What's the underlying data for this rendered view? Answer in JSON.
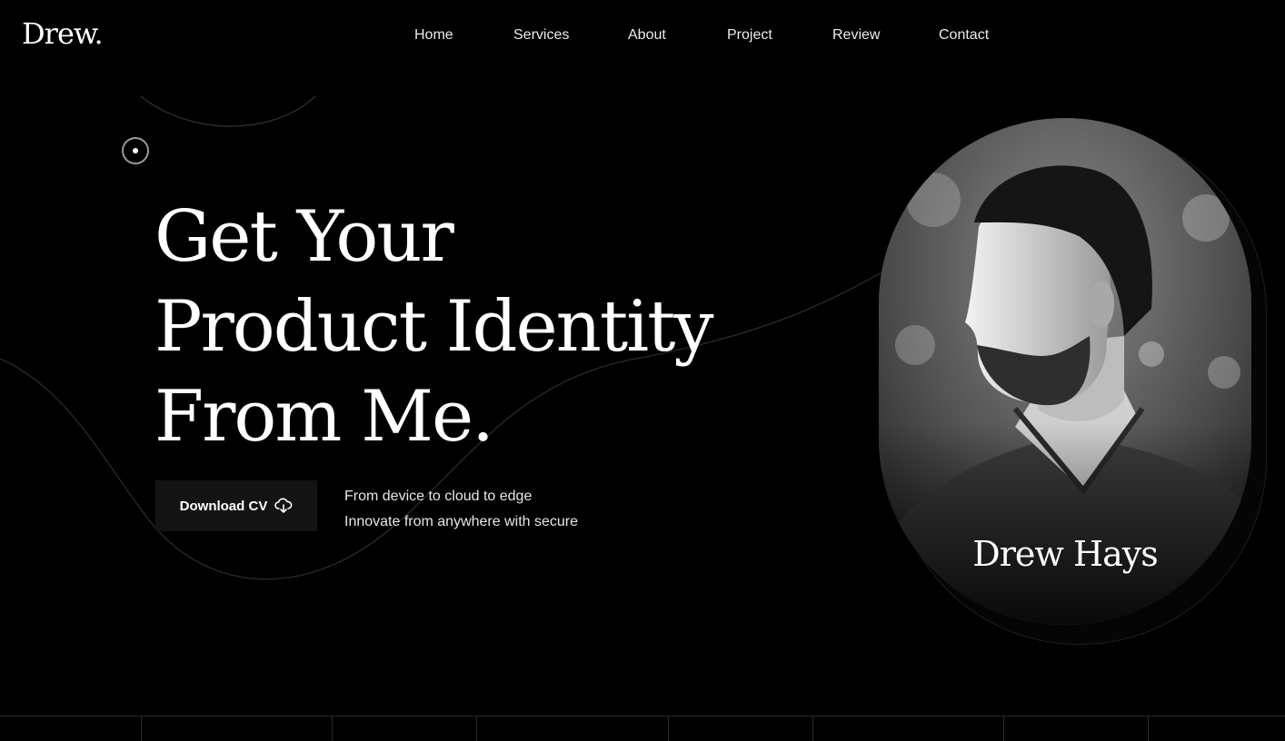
{
  "brand": {
    "logo": "Drew."
  },
  "nav": {
    "items": [
      {
        "label": "Home"
      },
      {
        "label": "Services"
      },
      {
        "label": "About"
      },
      {
        "label": "Project"
      },
      {
        "label": "Review"
      },
      {
        "label": "Contact"
      }
    ]
  },
  "hero": {
    "headline": [
      "Get Your",
      "Product Identity",
      "From Me."
    ],
    "cta_label": "Download CV",
    "cta_icon": "cloud-download-icon",
    "tagline": [
      "From device to cloud to edge",
      "Innovate from anywhere with secure"
    ]
  },
  "portrait": {
    "name": "Drew Hays",
    "style": "black-and-white"
  },
  "colors": {
    "background": "#000000",
    "text": "#ffffff",
    "button_bg": "#141414",
    "line": "#2a2a2a"
  }
}
